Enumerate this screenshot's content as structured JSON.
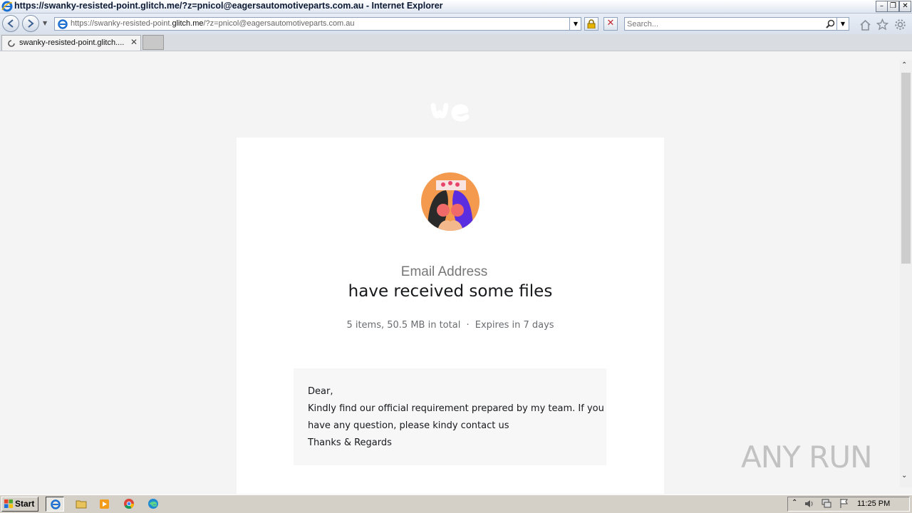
{
  "window": {
    "title": "https://swanky-resisted-point.glitch.me/?z=pnicol@eagersautomotiveparts.com.au - Internet Explorer"
  },
  "address_bar": {
    "prefix": "https://swanky-resisted-point.",
    "domain": "glitch.me",
    "suffix": "/?z=pnicol@eagersautomotiveparts.com.au"
  },
  "search": {
    "placeholder": "Search..."
  },
  "tab": {
    "label": "swanky-resisted-point.glitch...."
  },
  "page": {
    "email_label": "Email Address",
    "headline": "have received some files",
    "meta": "5 items, 50.5 MB in total",
    "separator": "·",
    "expires": "Expires in 7 days",
    "message_lines": [
      "Dear,",
      "Kindly find our official requirement prepared by my team. If you",
      "have any question, please kindy contact us",
      "Thanks & Regards"
    ]
  },
  "watermark": "ANY RUN",
  "taskbar": {
    "start_label": "Start",
    "clock": "11:25 PM"
  },
  "colors": {
    "ie_blue": "#1c6fd1",
    "avatar_orange": "#f39a4f",
    "avatar_purple": "#5b2de0"
  }
}
